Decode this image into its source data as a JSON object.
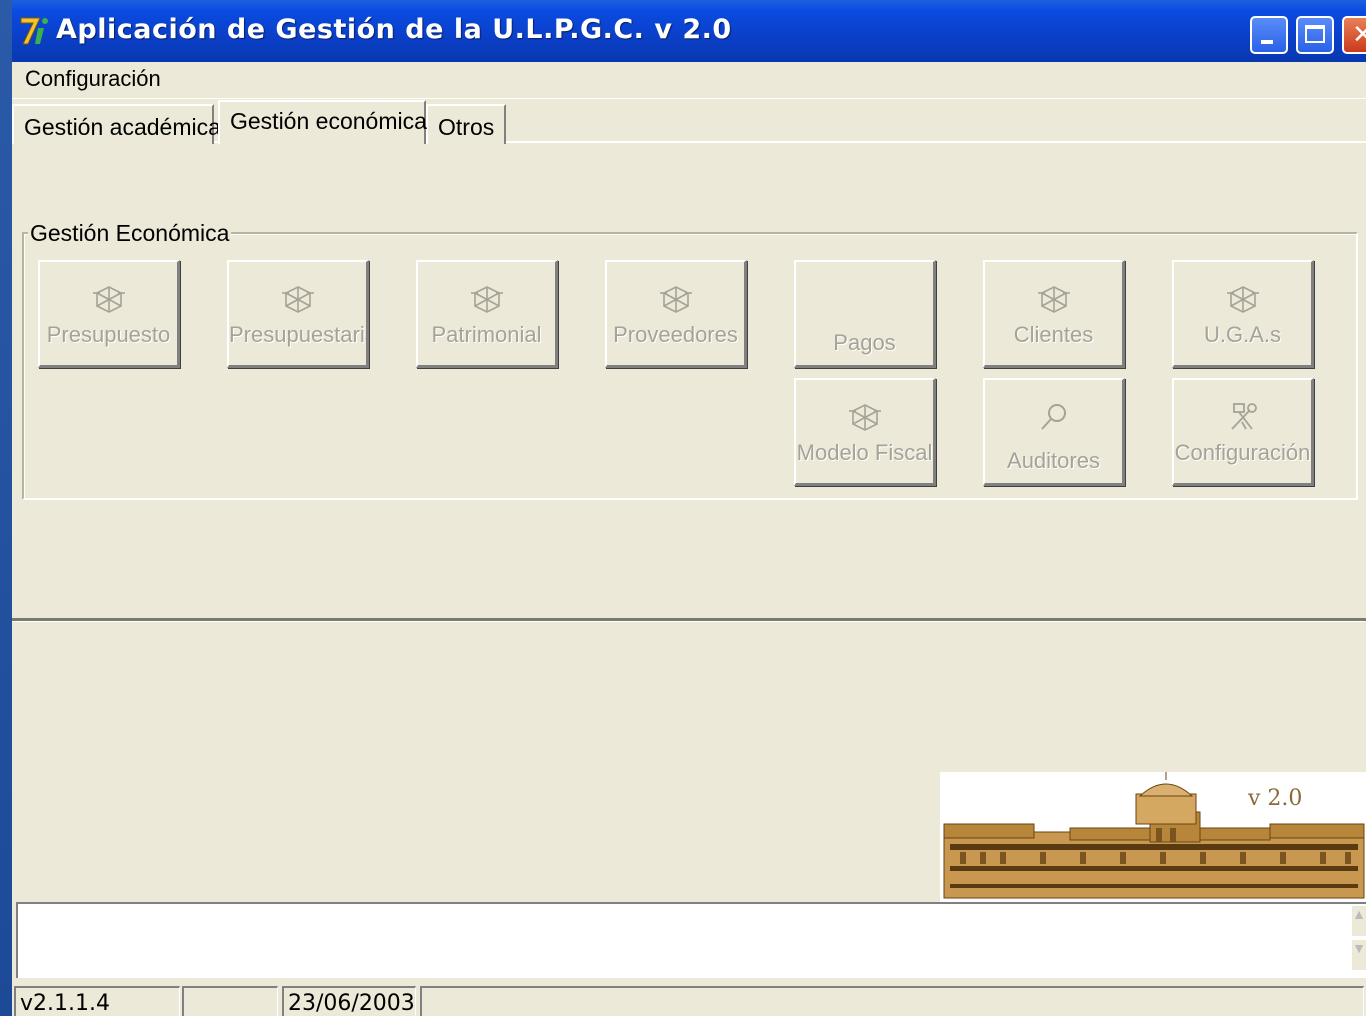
{
  "window": {
    "title": "Aplicación de Gestión de la U.L.P.G.C.  v 2.0",
    "app_icon": "7i-logo-icon",
    "controls": [
      "minimize-icon",
      "maximize-icon",
      "close-icon"
    ]
  },
  "menubar": {
    "items": [
      {
        "label": "Configuración"
      }
    ]
  },
  "tabs": [
    {
      "label": "Gestión académica",
      "selected": false
    },
    {
      "label": "Gestión económica",
      "selected": true
    },
    {
      "label": "Otros",
      "selected": false
    }
  ],
  "group": {
    "label": "Gestión Económica",
    "buttons": [
      {
        "label": "Presupuesto",
        "icon": "wireframe-cube-icon",
        "enabled": false
      },
      {
        "label": "Presupuestaria",
        "icon": "wireframe-cube-icon",
        "enabled": false
      },
      {
        "label": "Patrimonial",
        "icon": "wireframe-cube-icon",
        "enabled": false
      },
      {
        "label": "Proveedores",
        "icon": "wireframe-cube-icon",
        "enabled": false
      },
      {
        "label": "Pagos",
        "icon": "",
        "enabled": false
      },
      {
        "label": "Clientes",
        "icon": "wireframe-cube-icon",
        "enabled": false
      },
      {
        "label": "U.G.A.s",
        "icon": "wireframe-cube-icon",
        "enabled": false
      },
      {
        "label": "Modelo Fiscal",
        "icon": "wireframe-cube-icon",
        "enabled": false
      },
      {
        "label": "Auditores",
        "icon": "magnifier-icon",
        "enabled": false
      },
      {
        "label": "Configuración",
        "icon": "tools-icon",
        "enabled": false
      }
    ]
  },
  "banner": {
    "version": "v 2.0",
    "image": "university-building-illustration"
  },
  "statusbar": {
    "version": "v2.1.1.4",
    "empty": "",
    "date": "23/06/2003",
    "message": ""
  },
  "colors": {
    "titlebar": "#0b3fc8",
    "face": "#ece9d8",
    "disabled_text": "#a5a298"
  }
}
